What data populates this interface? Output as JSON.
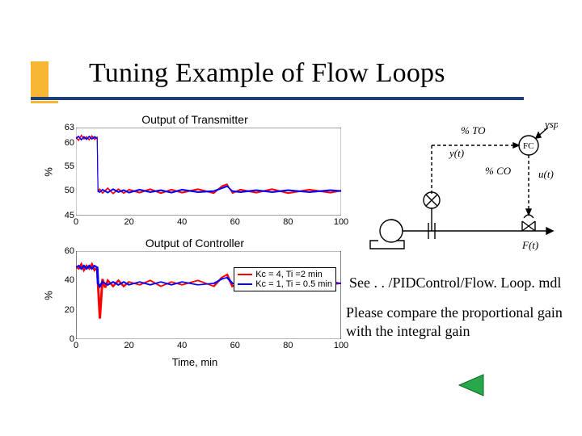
{
  "title": "Tuning Example of Flow Loops",
  "colors": {
    "accent": "#f7b733",
    "bar": "#1f3e78",
    "series_a": "#ff0000",
    "series_b": "#0000ff",
    "nav": "#27a84a"
  },
  "chart_data": [
    {
      "type": "line",
      "title": "Output of Transmitter",
      "ylabel": "%",
      "xlabel": "",
      "xlim": [
        0,
        100
      ],
      "ylim": [
        45,
        63
      ],
      "xticks": [
        0,
        20,
        40,
        60,
        80,
        100
      ],
      "yticks": [
        45,
        50,
        55,
        60,
        63
      ],
      "series": [
        {
          "name": "Kc = 4, Ti =2 min",
          "color": "#ff0000",
          "x": [
            0,
            8,
            9,
            20,
            40,
            55,
            60,
            80,
            100
          ],
          "values": [
            61,
            61,
            50,
            50,
            50,
            51,
            50,
            50,
            50
          ]
        },
        {
          "name": "Kc = 1, Ti = 0.5 min",
          "color": "#0000ff",
          "x": [
            0,
            8,
            9,
            20,
            40,
            55,
            60,
            80,
            100
          ],
          "values": [
            61,
            61,
            50,
            50,
            50,
            51,
            50,
            50,
            50
          ]
        }
      ]
    },
    {
      "type": "line",
      "title": "Output of Controller",
      "ylabel": "%",
      "xlabel": "Time, min",
      "xlim": [
        0,
        100
      ],
      "ylim": [
        0,
        60
      ],
      "xticks": [
        0,
        20,
        40,
        60,
        80,
        100
      ],
      "yticks": [
        0,
        20,
        40,
        60
      ],
      "legend": true,
      "series": [
        {
          "name": "Kc = 4, Ti =2 min",
          "color": "#ff0000",
          "x": [
            0,
            8,
            9,
            20,
            40,
            55,
            60,
            80,
            100
          ],
          "values": [
            49,
            49,
            38,
            38,
            38,
            39,
            38,
            38,
            38
          ]
        },
        {
          "name": "Kc = 1, Ti = 0.5 min",
          "color": "#0000ff",
          "x": [
            0,
            8,
            9,
            20,
            40,
            55,
            60,
            80,
            100
          ],
          "values": [
            49,
            49,
            38,
            38,
            38,
            39,
            38,
            38,
            38
          ]
        }
      ]
    }
  ],
  "diagram": {
    "labels": {
      "to": "% TO",
      "co": "% CO",
      "ysp": "ysp(t)",
      "y": "y(t)",
      "u": "u(t)",
      "F": "F(t)",
      "fc": "FC"
    }
  },
  "notes": {
    "see": "See . . /PIDControl/Flow. Loop. mdl",
    "compare": "Please compare the proportional gain with the integral gain"
  },
  "nav": {
    "back_label": "back"
  }
}
